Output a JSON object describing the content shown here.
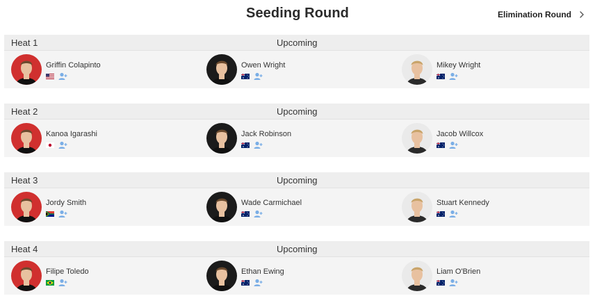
{
  "page": {
    "title": "Seeding Round",
    "next_round_label": "Elimination Round"
  },
  "colors": {
    "avatar_red": "#d0302f",
    "avatar_black": "#1b1b1b",
    "avatar_light": "#eaeaea",
    "add_icon": "#4a90e2"
  },
  "heats": [
    {
      "name": "Heat 1",
      "status": "Upcoming",
      "surfers": [
        {
          "name": "Griffin Colapinto",
          "flag": "us",
          "avatar_bg": "red"
        },
        {
          "name": "Owen Wright",
          "flag": "au",
          "avatar_bg": "black"
        },
        {
          "name": "Mikey Wright",
          "flag": "au",
          "avatar_bg": "light"
        }
      ]
    },
    {
      "name": "Heat 2",
      "status": "Upcoming",
      "surfers": [
        {
          "name": "Kanoa Igarashi",
          "flag": "jp",
          "avatar_bg": "red"
        },
        {
          "name": "Jack Robinson",
          "flag": "au",
          "avatar_bg": "black"
        },
        {
          "name": "Jacob Willcox",
          "flag": "au",
          "avatar_bg": "light"
        }
      ]
    },
    {
      "name": "Heat 3",
      "status": "Upcoming",
      "surfers": [
        {
          "name": "Jordy Smith",
          "flag": "za",
          "avatar_bg": "red"
        },
        {
          "name": "Wade Carmichael",
          "flag": "au",
          "avatar_bg": "black"
        },
        {
          "name": "Stuart Kennedy",
          "flag": "au",
          "avatar_bg": "light"
        }
      ]
    },
    {
      "name": "Heat 4",
      "status": "Upcoming",
      "surfers": [
        {
          "name": "Filipe Toledo",
          "flag": "br",
          "avatar_bg": "red"
        },
        {
          "name": "Ethan Ewing",
          "flag": "au",
          "avatar_bg": "black"
        },
        {
          "name": "Liam O'Brien",
          "flag": "au",
          "avatar_bg": "light"
        }
      ]
    }
  ]
}
